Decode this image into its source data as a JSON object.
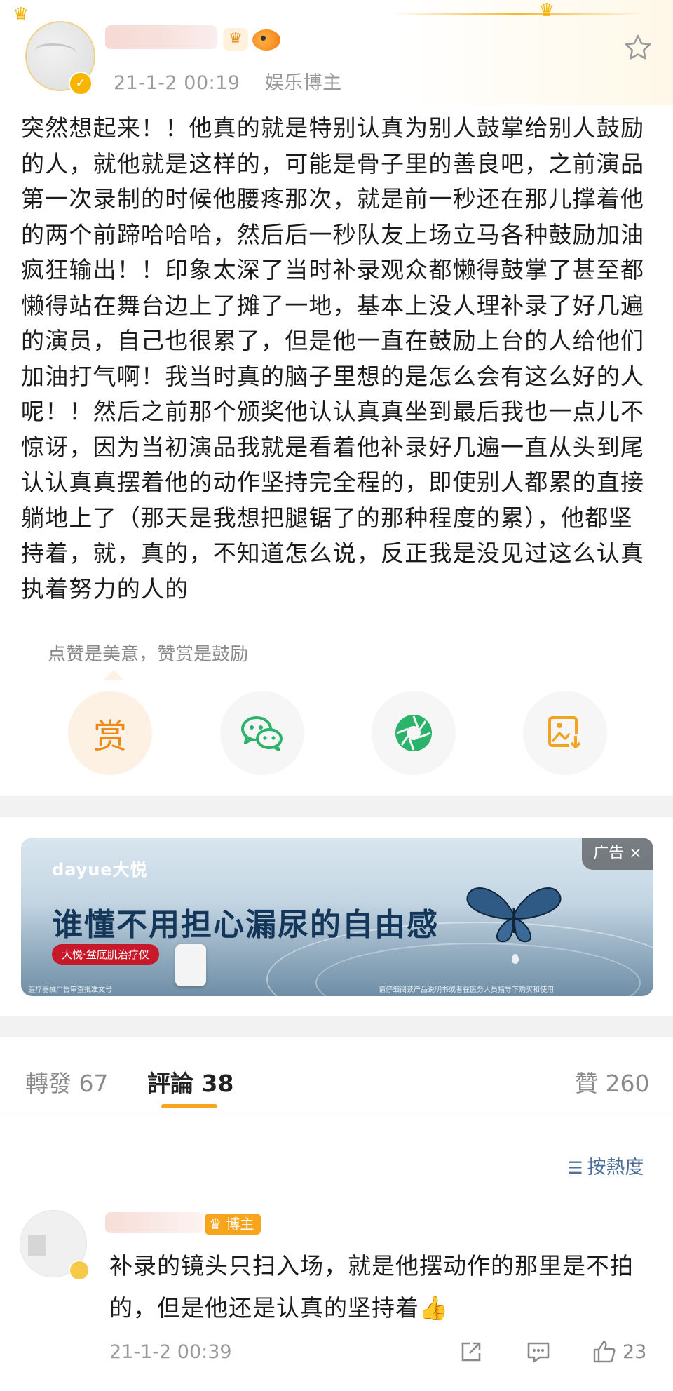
{
  "post": {
    "author_meta": {
      "time": "21-1-2 00:19",
      "role": "娱乐博主"
    },
    "text": "突然想起来！！他真的就是特别认真为别人鼓掌给别人鼓励的人，就他就是这样的，可能是骨子里的善良吧，之前演品第一次录制的时候他腰疼那次，就是前一秒还在那儿撑着他的两个前蹄哈哈哈，然后后一秒队友上场立马各种鼓励加油疯狂输出！！印象太深了当时补录观众都懒得鼓掌了甚至都懒得站在舞台边上了摊了一地，基本上没人理补录了好几遍的演员，自己也很累了，但是他一直在鼓励上台的人给他们加油打气啊！我当时真的脑子里想的是怎么会有这么好的人呢！！然后之前那个颁奖他认认真真坐到最后我也一点儿不惊讶，因为当初演品我就是看着他补录好几遍一直从头到尾认认真真摆着他的动作坚持完全程的，即使别人都累的直接躺地上了（那天是我想把腿锯了的那种程度的累），他都坚持着，就，真的，不知道怎么说，反正我是没见过这么认真执着努力的人的"
  },
  "reward": {
    "tip": "点赞是美意，赞赏是鼓励",
    "reward_char": "赏",
    "share_icons": [
      "reward-icon",
      "wechat-icon",
      "moments-icon",
      "save-image-icon"
    ]
  },
  "ad": {
    "brand": "dayue大悦",
    "headline": "谁懂不用担心漏尿的自由感",
    "pill": "大悦·盆底肌治疗仪",
    "tag": "广告 ×",
    "fine_left": "医疗器械广告审查批准文号",
    "fine_right": "请仔细阅读产品说明书或者在医务人员指导下购买和使用"
  },
  "tabs": {
    "repost_label": "轉發",
    "repost_count": "67",
    "comment_label": "評論",
    "comment_count": "38",
    "like_label": "贊",
    "like_count": "260"
  },
  "sort": {
    "label": "按熱度"
  },
  "comment": {
    "badge": "博主",
    "text": "补录的镜头只扫入场，就是他摆动作的那里是不拍的，但是他还是认真的坚持着👍",
    "time": "21-1-2 00:39",
    "like_count": "23"
  },
  "colors": {
    "accent_orange": "#f7a51c",
    "sort_blue": "#4d6f98",
    "wechat_green": "#2bb36b"
  }
}
